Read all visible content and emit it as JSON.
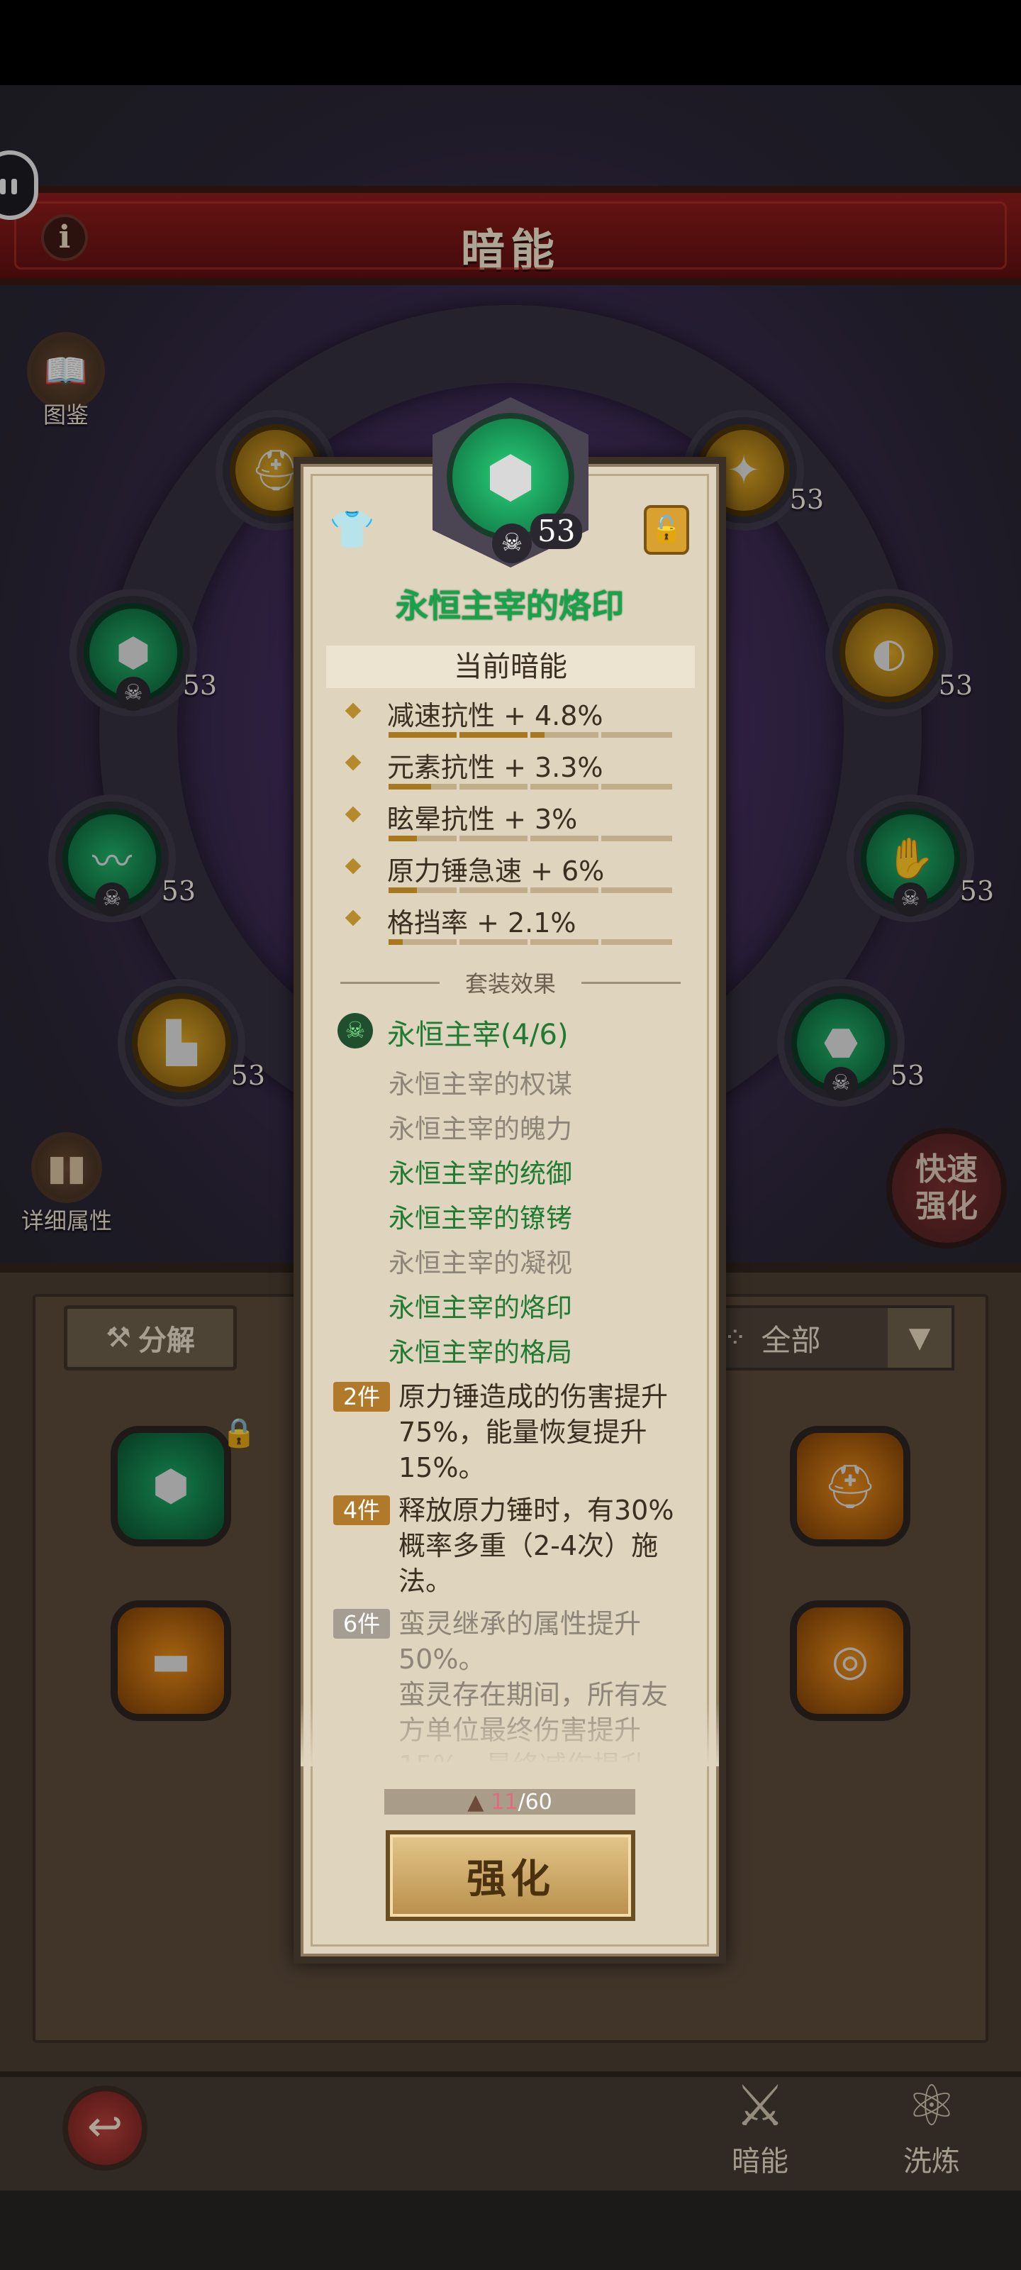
{
  "header": {
    "title": "暗能"
  },
  "side": {
    "codex": "图鉴",
    "details": "详细属性",
    "quick_upgrade": "快速强化"
  },
  "ring_gems": [
    {
      "level": "53",
      "color": "gold"
    },
    {
      "level": "53",
      "color": "gold"
    },
    {
      "level": "53",
      "color": "green"
    },
    {
      "level": "53",
      "color": "gold"
    },
    {
      "level": "53",
      "color": "green"
    },
    {
      "level": "53",
      "color": "green"
    },
    {
      "level": "53",
      "color": "gold"
    },
    {
      "level": "53",
      "color": "green"
    }
  ],
  "inventory": {
    "dismantle": "分解",
    "filter": "全部"
  },
  "popup": {
    "level": "53",
    "name": "永恒主宰的烙印",
    "current_header": "当前暗能",
    "stats": [
      {
        "text": "减速抗性 + 4.8%",
        "fill": 0.55
      },
      {
        "text": "元素抗性 + 3.3%",
        "fill": 0.15
      },
      {
        "text": "眩晕抗性 + 3%",
        "fill": 0.1
      },
      {
        "text": "原力锤急速 + 6%",
        "fill": 0.1
      },
      {
        "text": "格挡率 + 2.1%",
        "fill": 0.05
      }
    ],
    "set_label": "套装效果",
    "set_name": "永恒主宰(4/6)",
    "pieces": [
      {
        "name": "永恒主宰的权谋",
        "owned": false
      },
      {
        "name": "永恒主宰的魄力",
        "owned": false
      },
      {
        "name": "永恒主宰的统御",
        "owned": true
      },
      {
        "name": "永恒主宰的镣铐",
        "owned": true
      },
      {
        "name": "永恒主宰的凝视",
        "owned": false
      },
      {
        "name": "永恒主宰的烙印",
        "owned": true
      },
      {
        "name": "永恒主宰的格局",
        "owned": true
      }
    ],
    "bonuses": [
      {
        "tag": "2件",
        "text": "原力锤造成的伤害提升75%，能量恢复提升15%。",
        "active": true
      },
      {
        "tag": "4件",
        "text": "释放原力锤时，有30%概率多重（2-4次）施法。",
        "active": true
      },
      {
        "tag": "6件",
        "text": "蛮灵继承的属性提升50%。\n蛮灵存在期间，所有友方单位最终伤害提升15%，最终减伤提升",
        "active": false
      }
    ],
    "material": {
      "have": "11",
      "need": "/60"
    },
    "upgrade": "强化"
  },
  "nav": {
    "dark_energy": "暗能",
    "refine": "洗炼"
  },
  "colors": {
    "green_text": "#1f7a33",
    "inactive_text": "#8d8578",
    "banner": "#8d1d1a"
  }
}
